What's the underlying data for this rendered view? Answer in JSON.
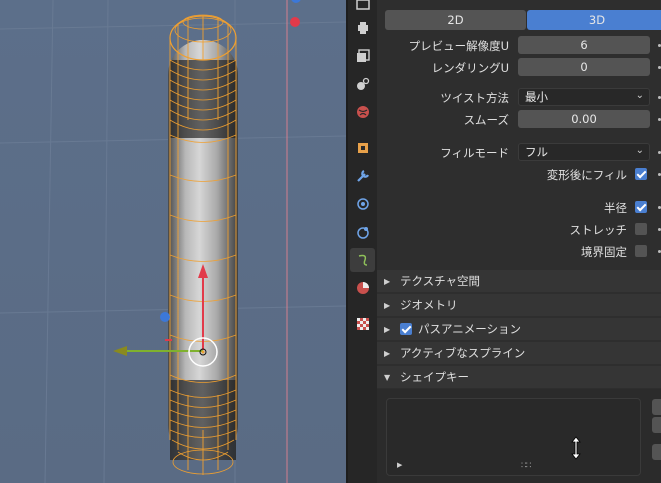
{
  "panel": {
    "mode_2d": "2D",
    "mode_3d": "3D",
    "preview_resolution_label": "プレビュー解像度U",
    "preview_resolution_value": "6",
    "render_resolution_label": "レンダリングU",
    "render_resolution_value": "0",
    "twist_method_label": "ツイスト方法",
    "twist_method_value": "最小",
    "smooth_label": "スムーズ",
    "smooth_value": "0.00",
    "fill_mode_label": "フィルモード",
    "fill_mode_value": "フル",
    "fill_deformed_label": "変形後にフィル",
    "fill_deformed_checked": true,
    "radius_label": "半径",
    "radius_checked": true,
    "stretch_label": "ストレッチ",
    "stretch_checked": false,
    "bounds_clamp_label": "境界固定",
    "bounds_clamp_checked": false
  },
  "sections": [
    {
      "label": "テクスチャ空間",
      "expanded": false,
      "has_checkbox": false
    },
    {
      "label": "ジオメトリ",
      "expanded": false,
      "has_checkbox": false
    },
    {
      "label": "パスアニメーション",
      "expanded": false,
      "has_checkbox": true,
      "checked": true
    },
    {
      "label": "アクティブなスプライン",
      "expanded": false,
      "has_checkbox": false
    },
    {
      "label": "シェイプキー",
      "expanded": true,
      "has_checkbox": false
    }
  ],
  "tabs": [
    {
      "name": "render-icon"
    },
    {
      "name": "output-icon"
    },
    {
      "name": "view-layer-icon"
    },
    {
      "name": "scene-icon"
    },
    {
      "name": "world-icon"
    },
    {
      "name": "object-icon"
    },
    {
      "name": "modifier-icon"
    },
    {
      "name": "particles-icon"
    },
    {
      "name": "physics-icon"
    },
    {
      "name": "curve-data-icon"
    },
    {
      "name": "material-icon"
    },
    {
      "name": "texture-icon"
    }
  ],
  "colors": {
    "accent": "#4a7fd1",
    "wire": "#f0a030",
    "axis_x": "#e23a4a",
    "axis_y": "#7fb12e",
    "axis_z": "#3c78d8"
  }
}
